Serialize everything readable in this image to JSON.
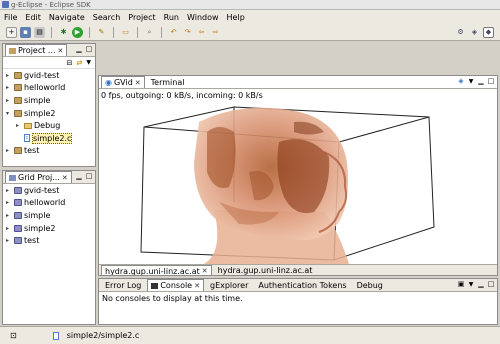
{
  "window": {
    "title": "g-Eclipse - Eclipse SDK"
  },
  "menu": [
    "File",
    "Edit",
    "Navigate",
    "Search",
    "Project",
    "Run",
    "Window",
    "Help"
  ],
  "toolbar": {
    "icons": [
      "new-icon",
      "save-icon",
      "print-icon",
      "debug-icon",
      "run-icon",
      "tool-icon",
      "open-icon",
      "search-icon",
      "nav-back-icon",
      "nav-forward-icon"
    ]
  },
  "project_explorer": {
    "title": "Project ...",
    "items": [
      {
        "label": "gvid-test",
        "level": 0,
        "type": "project",
        "expanded": false
      },
      {
        "label": "helloworld",
        "level": 0,
        "type": "project",
        "expanded": false
      },
      {
        "label": "simple",
        "level": 0,
        "type": "project",
        "expanded": false
      },
      {
        "label": "simple2",
        "level": 0,
        "type": "project",
        "expanded": true
      },
      {
        "label": "Debug",
        "level": 1,
        "type": "folder",
        "expanded": false
      },
      {
        "label": "simple2.c",
        "level": 1,
        "type": "file",
        "selected": true
      },
      {
        "label": "test",
        "level": 0,
        "type": "project",
        "expanded": false
      }
    ]
  },
  "grid_projects": {
    "title": "Grid Proj...",
    "items": [
      {
        "label": "gvid-test"
      },
      {
        "label": "helloworld"
      },
      {
        "label": "simple"
      },
      {
        "label": "simple2"
      },
      {
        "label": "test"
      }
    ]
  },
  "editor": {
    "tabs": [
      {
        "label": "GVid",
        "active": true
      },
      {
        "label": "Terminal",
        "active": false
      }
    ],
    "stats": "0 fps, outgoing: 0 kB/s, incoming: 0 kB/s",
    "host_tabs": [
      {
        "label": "hydra.gup.uni-linz.ac.at",
        "active": true
      },
      {
        "label": "hydra.gup.uni-linz.ac.at",
        "active": false
      }
    ]
  },
  "console": {
    "tabs": [
      {
        "label": "Error Log",
        "active": false
      },
      {
        "label": "Console",
        "active": true
      },
      {
        "label": "gExplorer",
        "active": false
      },
      {
        "label": "Authentication Tokens",
        "active": false
      },
      {
        "label": "Debug",
        "active": false
      }
    ],
    "message": "No consoles to display at this time."
  },
  "status": {
    "path": "simple2/simple2.c"
  }
}
